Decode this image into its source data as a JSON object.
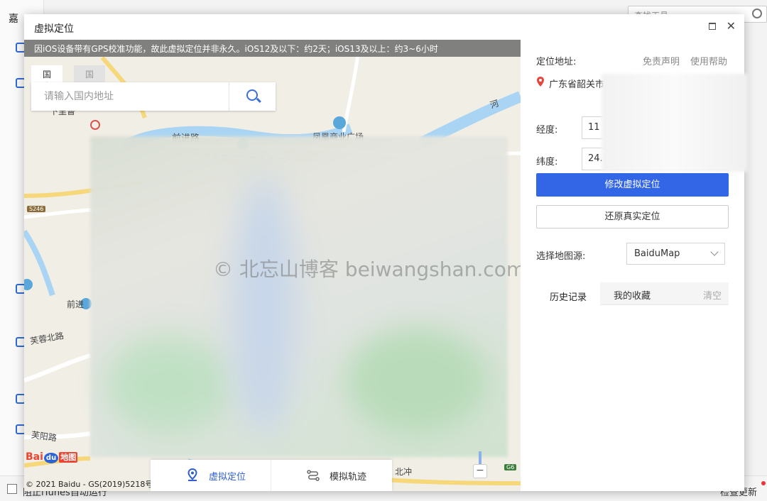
{
  "background_app": {
    "title_fragment": "嘉",
    "search_placeholder": "查找工具",
    "bottom_checkbox_label": "阻止iTunes自动运行",
    "bottom_right_text": "检查更新"
  },
  "dialog": {
    "title": "虚拟定位"
  },
  "map": {
    "notice": "因iOS设备带有GPS校准功能，故此虚拟定位并非永久。iOS12及以下：约2天；iOS13及以上：约3~6小时",
    "search_tabs": [
      "国内",
      "国外"
    ],
    "search_placeholder": "请输入国内地址",
    "labels": {
      "road_qianjin": "前进路",
      "plaza": "凤凰商业广场",
      "road_furong_north": "芙蓉北路",
      "road_furong_yang": "芙阳路",
      "road_qianjin2": "前进",
      "place_beichong": "北冲",
      "place_left_top": "下里督",
      "highway_badge": "S246",
      "highway_badge2": "G6",
      "river_fragment": "河"
    },
    "watermark": "© 北忘山博客 beiwangshan.com",
    "logo": {
      "bai": "Bai",
      "du": "du",
      "map": "地图"
    },
    "copyright": "© 2021 Baidu - GS(2019)5218号",
    "bottom_tabs": [
      "虚拟定位",
      "模拟轨迹"
    ],
    "zoom_minus": "−"
  },
  "panel": {
    "location_label": "定位地址:",
    "disclaimer": "免责声明",
    "help": "使用帮助",
    "address": "广东省韶关市",
    "lng_label": "经度:",
    "lng_value": "11",
    "lat_label": "纬度:",
    "lat_value": "24.",
    "modify_button": "修改虚拟定位",
    "restore_button": "还原真实定位",
    "source_label": "选择地图源:",
    "source_value": "BaiduMap",
    "history_tab": "历史记录",
    "favorites_tab": "我的收藏",
    "clear": "清空"
  },
  "colors": {
    "primary": "#3366e6",
    "notice_bg": "#6e6e6e",
    "pin_red": "#e8453c"
  }
}
